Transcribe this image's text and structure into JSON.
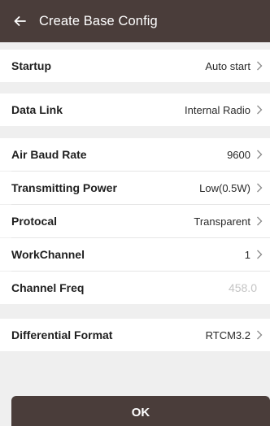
{
  "header": {
    "title": "Create Base Config",
    "back_icon": "arrow-left-icon"
  },
  "rows": {
    "startup": {
      "label": "Startup",
      "value": "Auto start"
    },
    "data_link": {
      "label": "Data Link",
      "value": "Internal Radio"
    },
    "air_baud_rate": {
      "label": "Air Baud Rate",
      "value": "9600"
    },
    "transmitting_power": {
      "label": "Transmitting Power",
      "value": "Low(0.5W)"
    },
    "protocol": {
      "label": "Protocal",
      "value": "Transparent"
    },
    "work_channel": {
      "label": "WorkChannel",
      "value": "1"
    },
    "channel_freq": {
      "label": "Channel Freq",
      "value": "458.0"
    },
    "differential_format": {
      "label": "Differential Format",
      "value": "RTCM3.2"
    }
  },
  "footer": {
    "ok_label": "OK"
  },
  "colors": {
    "header_bg": "#4a3d3a",
    "page_bg": "#efefef",
    "muted_value": "#c4c4c4"
  }
}
